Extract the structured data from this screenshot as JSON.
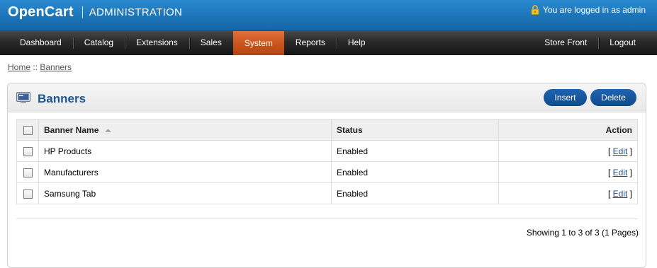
{
  "header": {
    "brand": "OpenCart",
    "subtitle": "ADMINISTRATION",
    "login_text": "You are logged in as admin"
  },
  "menu": {
    "left": [
      "Dashboard",
      "Catalog",
      "Extensions",
      "Sales",
      "System",
      "Reports",
      "Help"
    ],
    "active": "System",
    "right": [
      "Store Front",
      "Logout"
    ]
  },
  "breadcrumb": {
    "home": "Home",
    "separator": " :: ",
    "current": "Banners"
  },
  "panel": {
    "title": "Banners",
    "insert_label": "Insert",
    "delete_label": "Delete"
  },
  "table": {
    "columns": [
      "Banner Name",
      "Status",
      "Action"
    ],
    "sorted_column": "Banner Name",
    "rows": [
      {
        "name": "HP Products",
        "status": "Enabled",
        "action_open": "[ ",
        "action": "Edit",
        "action_close": " ]"
      },
      {
        "name": "Manufacturers",
        "status": "Enabled",
        "action_open": "[ ",
        "action": "Edit",
        "action_close": " ]"
      },
      {
        "name": "Samsung Tab",
        "status": "Enabled",
        "action_open": "[ ",
        "action": "Edit",
        "action_close": " ]"
      }
    ]
  },
  "pagination": {
    "results": "Showing 1 to 3 of 3 (1 Pages)"
  },
  "icons": {
    "lock": "lock-icon",
    "banner": "banner-icon",
    "sort": "sort-ascending-icon"
  },
  "colors": {
    "header_blue": "#1c74b8",
    "menu_dark": "#2a2a2a",
    "menu_active": "#c9541c",
    "title_blue": "#1e5591",
    "button_blue": "#15559d"
  }
}
